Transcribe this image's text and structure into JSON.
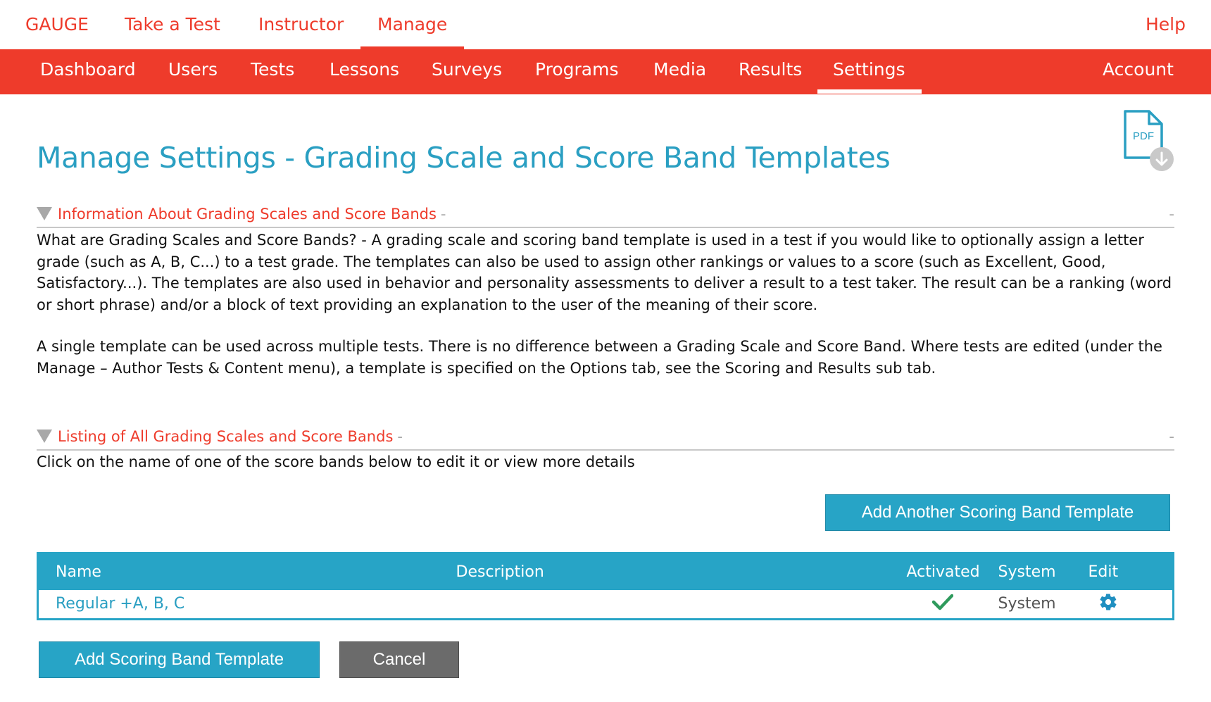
{
  "top_nav": {
    "brand": "GAUGE",
    "items": [
      "Take a Test",
      "Instructor",
      "Manage"
    ],
    "active": "Manage",
    "help": "Help"
  },
  "sub_nav": {
    "items": [
      "Dashboard",
      "Users",
      "Tests",
      "Lessons",
      "Surveys",
      "Programs",
      "Media",
      "Results",
      "Settings"
    ],
    "active": "Settings",
    "account": "Account"
  },
  "pdf_icon": {
    "label": "PDF",
    "icon": "pdf-download-icon"
  },
  "page_title": "Manage Settings - Grading Scale and Score Band Templates",
  "info_section": {
    "heading": "Information About Grading Scales and Score Bands",
    "toggle": "-",
    "lead": "What are Grading Scales and Score Bands?",
    "para1": " - A grading scale and scoring band template is used in a test if you would like to optionally assign a letter grade (such as A, B, C...) to a test grade. The templates can also be used to assign other rankings or values to a score (such as Excellent, Good, Satisfactory...). The templates are also used in behavior and personality assessments to deliver a result to a test taker. The result can be a ranking (word or short phrase) and/or a block of text providing an explanation to the user of the meaning of their score.",
    "para2": "A single template can be used across multiple tests. There is no difference between a Grading Scale and Score Band. Where tests are edited (under the Manage – Author Tests & Content menu), a template is specified on the Options tab, see the Scoring and Results sub tab."
  },
  "listing_section": {
    "heading": "Listing of All Grading Scales and Score Bands",
    "toggle": "-",
    "instruction": "Click on the name of one of the score bands below to edit it or view more details",
    "add_another_label": "Add Another Scoring Band Template",
    "columns": [
      "Name",
      "Description",
      "Activated",
      "System",
      "Edit"
    ],
    "rows": [
      {
        "name": "Regular +A, B, C",
        "description": "",
        "activated": true,
        "system": "System",
        "edit_icon": "gear-icon"
      }
    ]
  },
  "footer_buttons": {
    "add_label": "Add Scoring Band Template",
    "cancel_label": "Cancel"
  },
  "colors": {
    "brand_red": "#ee3b2b",
    "accent_blue": "#27a4c6",
    "title_blue": "#2a9fc2",
    "check_green": "#2e9a5c",
    "cancel_grey": "#6b6b6b"
  }
}
